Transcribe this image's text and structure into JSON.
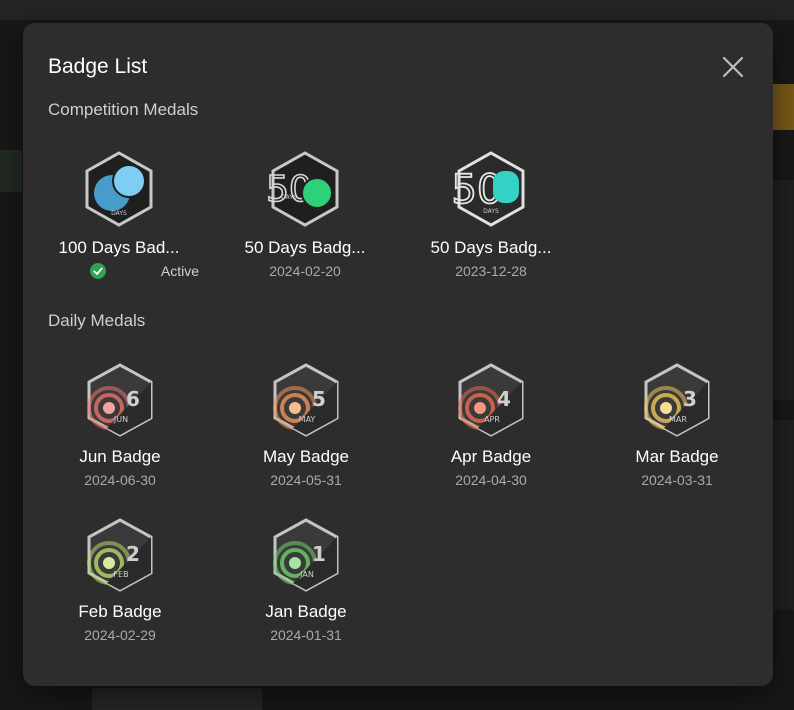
{
  "modal": {
    "title": "Badge List"
  },
  "sections": {
    "competition": {
      "title": "Competition Medals"
    },
    "daily": {
      "title": "Daily Medals"
    }
  },
  "competition_badges": [
    {
      "name": "100 Days Bad...",
      "status": "Active",
      "number_label": "",
      "sub_label": "DAYS",
      "accent": "#4fb3e8"
    },
    {
      "name": "50 Days Badg...",
      "date": "2024-02-20",
      "number_label": "50",
      "sub_label": "DAYS",
      "accent": "#2fd07a"
    },
    {
      "name": "50 Days Badg...",
      "date": "2023-12-28",
      "number_label": "50",
      "sub_label": "DAYS",
      "accent": "#34d1c6"
    }
  ],
  "daily_badges": [
    {
      "name": "Jun Badge",
      "date": "2024-06-30",
      "number": "6",
      "month": "JUN",
      "ring_color": "#e8726f"
    },
    {
      "name": "May Badge",
      "date": "2024-05-31",
      "number": "5",
      "month": "MAY",
      "ring_color": "#f0935a"
    },
    {
      "name": "Apr Badge",
      "date": "2024-04-30",
      "number": "4",
      "month": "APR",
      "ring_color": "#e66b4e"
    },
    {
      "name": "Mar Badge",
      "date": "2024-03-31",
      "number": "3",
      "month": "MAR",
      "ring_color": "#f0c45a"
    },
    {
      "name": "Feb Badge",
      "date": "2024-02-29",
      "number": "2",
      "month": "FEB",
      "ring_color": "#b6d86a"
    },
    {
      "name": "Jan Badge",
      "date": "2024-01-31",
      "number": "1",
      "month": "JAN",
      "ring_color": "#6fcf6a"
    }
  ],
  "colors": {
    "modal_bg": "#2d2d2d",
    "active_green": "#2ea44f",
    "badge_dark": "#1f1f1f",
    "badge_rim": "#bdbdbd"
  },
  "icons": {
    "close": "close-icon",
    "active": "check-circle-icon"
  }
}
